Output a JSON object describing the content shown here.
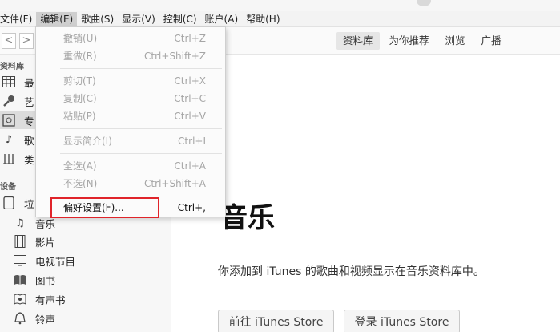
{
  "menubar": {
    "items": [
      "文件(F)",
      "编辑(E)",
      "歌曲(S)",
      "显示(V)",
      "控制(C)",
      "账户(A)",
      "帮助(H)"
    ]
  },
  "nav": {
    "back_glyph": "<",
    "forward_glyph": ">",
    "tabs": [
      "资料库",
      "为你推荐",
      "浏览",
      "广播"
    ]
  },
  "sidebar": {
    "library_header": "资料库",
    "library_items": [
      {
        "label": "最",
        "icon": "grid-icon"
      },
      {
        "label": "艺",
        "icon": "microphone-icon"
      },
      {
        "label": "专",
        "icon": "album-icon"
      },
      {
        "label": "歌",
        "icon": "music-note-icon"
      },
      {
        "label": "类",
        "icon": "genre-icon"
      }
    ],
    "devices_header": "设备",
    "device": {
      "label": "垃",
      "icon": "device-icon"
    },
    "device_items": [
      {
        "label": "音乐",
        "icon": "music-note-icon"
      },
      {
        "label": "影片",
        "icon": "film-icon"
      },
      {
        "label": "电视节目",
        "icon": "tv-icon"
      },
      {
        "label": "图书",
        "icon": "book-icon"
      },
      {
        "label": "有声书",
        "icon": "audiobook-icon"
      },
      {
        "label": "铃声",
        "icon": "bell-icon"
      }
    ]
  },
  "edit_menu": {
    "items": [
      {
        "label": "撤销(U)",
        "shortcut": "Ctrl+Z",
        "enabled": false
      },
      {
        "label": "重做(R)",
        "shortcut": "Ctrl+Shift+Z",
        "enabled": false
      },
      {
        "label": "剪切(T)",
        "shortcut": "Ctrl+X",
        "enabled": false
      },
      {
        "label": "复制(C)",
        "shortcut": "Ctrl+C",
        "enabled": false
      },
      {
        "label": "粘贴(P)",
        "shortcut": "Ctrl+V",
        "enabled": false
      },
      {
        "label": "显示简介(I)",
        "shortcut": "Ctrl+I",
        "enabled": false
      },
      {
        "label": "全选(A)",
        "shortcut": "Ctrl+A",
        "enabled": false
      },
      {
        "label": "不选(N)",
        "shortcut": "Ctrl+Shift+A",
        "enabled": false
      },
      {
        "label": "偏好设置(F)...",
        "shortcut": "Ctrl+,",
        "enabled": true
      }
    ]
  },
  "main": {
    "title": "音乐",
    "description": "你添加到 iTunes 的歌曲和视频显示在音乐资料库中。",
    "store_button": "前往 iTunes Store",
    "signin_button": "登录 iTunes Store"
  },
  "colors": {
    "highlight_border": "#e0242a",
    "menu_active_bg": "#cfcfcf"
  }
}
